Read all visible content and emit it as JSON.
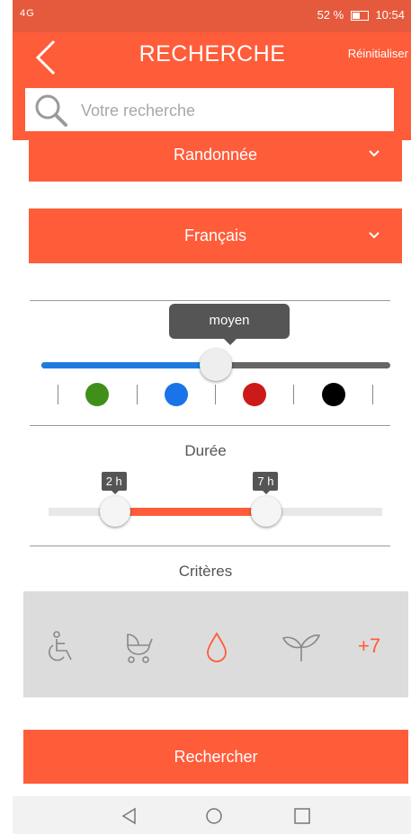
{
  "status_bar": {
    "network": "4G",
    "indicators": "⏰ ⏰ 🔕",
    "battery_percent": "52 %",
    "time": "10:54"
  },
  "header": {
    "title": "RECHERCHE",
    "reset_label": "Réinitialiser",
    "back_icon": "chevron-left-icon"
  },
  "search": {
    "placeholder": "Votre recherche",
    "value": "",
    "icon": "search-icon"
  },
  "filters": {
    "activity": "Randonnée",
    "language": "Français"
  },
  "difficulty": {
    "tooltip": "moyen",
    "value_fraction": 0.5,
    "levels": [
      {
        "color": "#3f8f1a"
      },
      {
        "color": "#1a73e8"
      },
      {
        "color": "#cc1a1a"
      },
      {
        "color": "#000000"
      }
    ]
  },
  "duration": {
    "label": "Durée",
    "min_value": 2,
    "max_value": 7,
    "min_label": "2 h",
    "max_label": "7 h"
  },
  "criteria": {
    "label": "Critères",
    "icons": [
      "wheelchair-icon",
      "stroller-icon",
      "water-drop-icon",
      "plant-sprout-icon"
    ],
    "more_label": "+7"
  },
  "actions": {
    "search_button": "Rechercher"
  },
  "colors": {
    "accent": "#ff5c3a",
    "slider_blue": "#1e7be0"
  }
}
